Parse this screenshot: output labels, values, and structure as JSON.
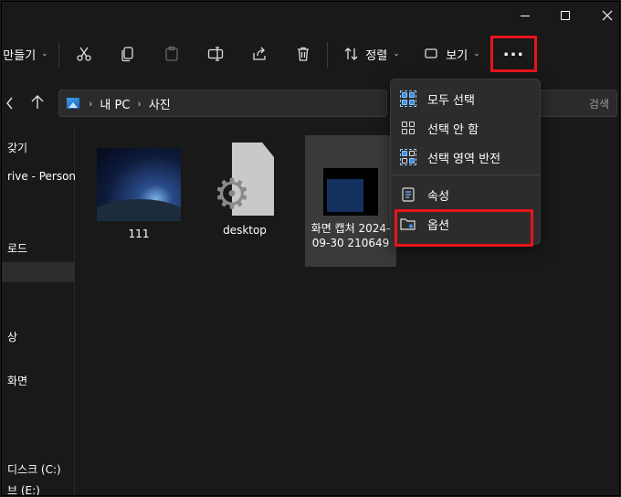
{
  "window": {
    "controls": [
      "minimize",
      "maximize",
      "close"
    ]
  },
  "toolbar": {
    "new_label": "만들기",
    "sort_label": "정렬",
    "view_label": "보기",
    "more_label": "..."
  },
  "address": {
    "crumbs": [
      "내 PC",
      "사진"
    ],
    "search_placeholder": "검색"
  },
  "sidebar": {
    "items": [
      {
        "label": "갖기"
      },
      {
        "label": "rive - Personal"
      },
      {
        "label": "로드"
      },
      {
        "label": ""
      },
      {
        "label": "상"
      },
      {
        "label": "화면"
      },
      {
        "label": "디스크 (C:)"
      },
      {
        "label": "브 (E:)"
      }
    ]
  },
  "files": [
    {
      "name": "111"
    },
    {
      "name": "desktop"
    },
    {
      "name": "화면 캡처 2024-09-30 210649"
    }
  ],
  "menu": {
    "items": [
      {
        "label": "모두 선택"
      },
      {
        "label": "선택 안 함"
      },
      {
        "label": "선택 영역 반전"
      },
      {
        "label": "속성"
      },
      {
        "label": "옵션"
      }
    ]
  },
  "colors": {
    "highlight": "#e8141a",
    "accent": "#3f8fe0"
  }
}
